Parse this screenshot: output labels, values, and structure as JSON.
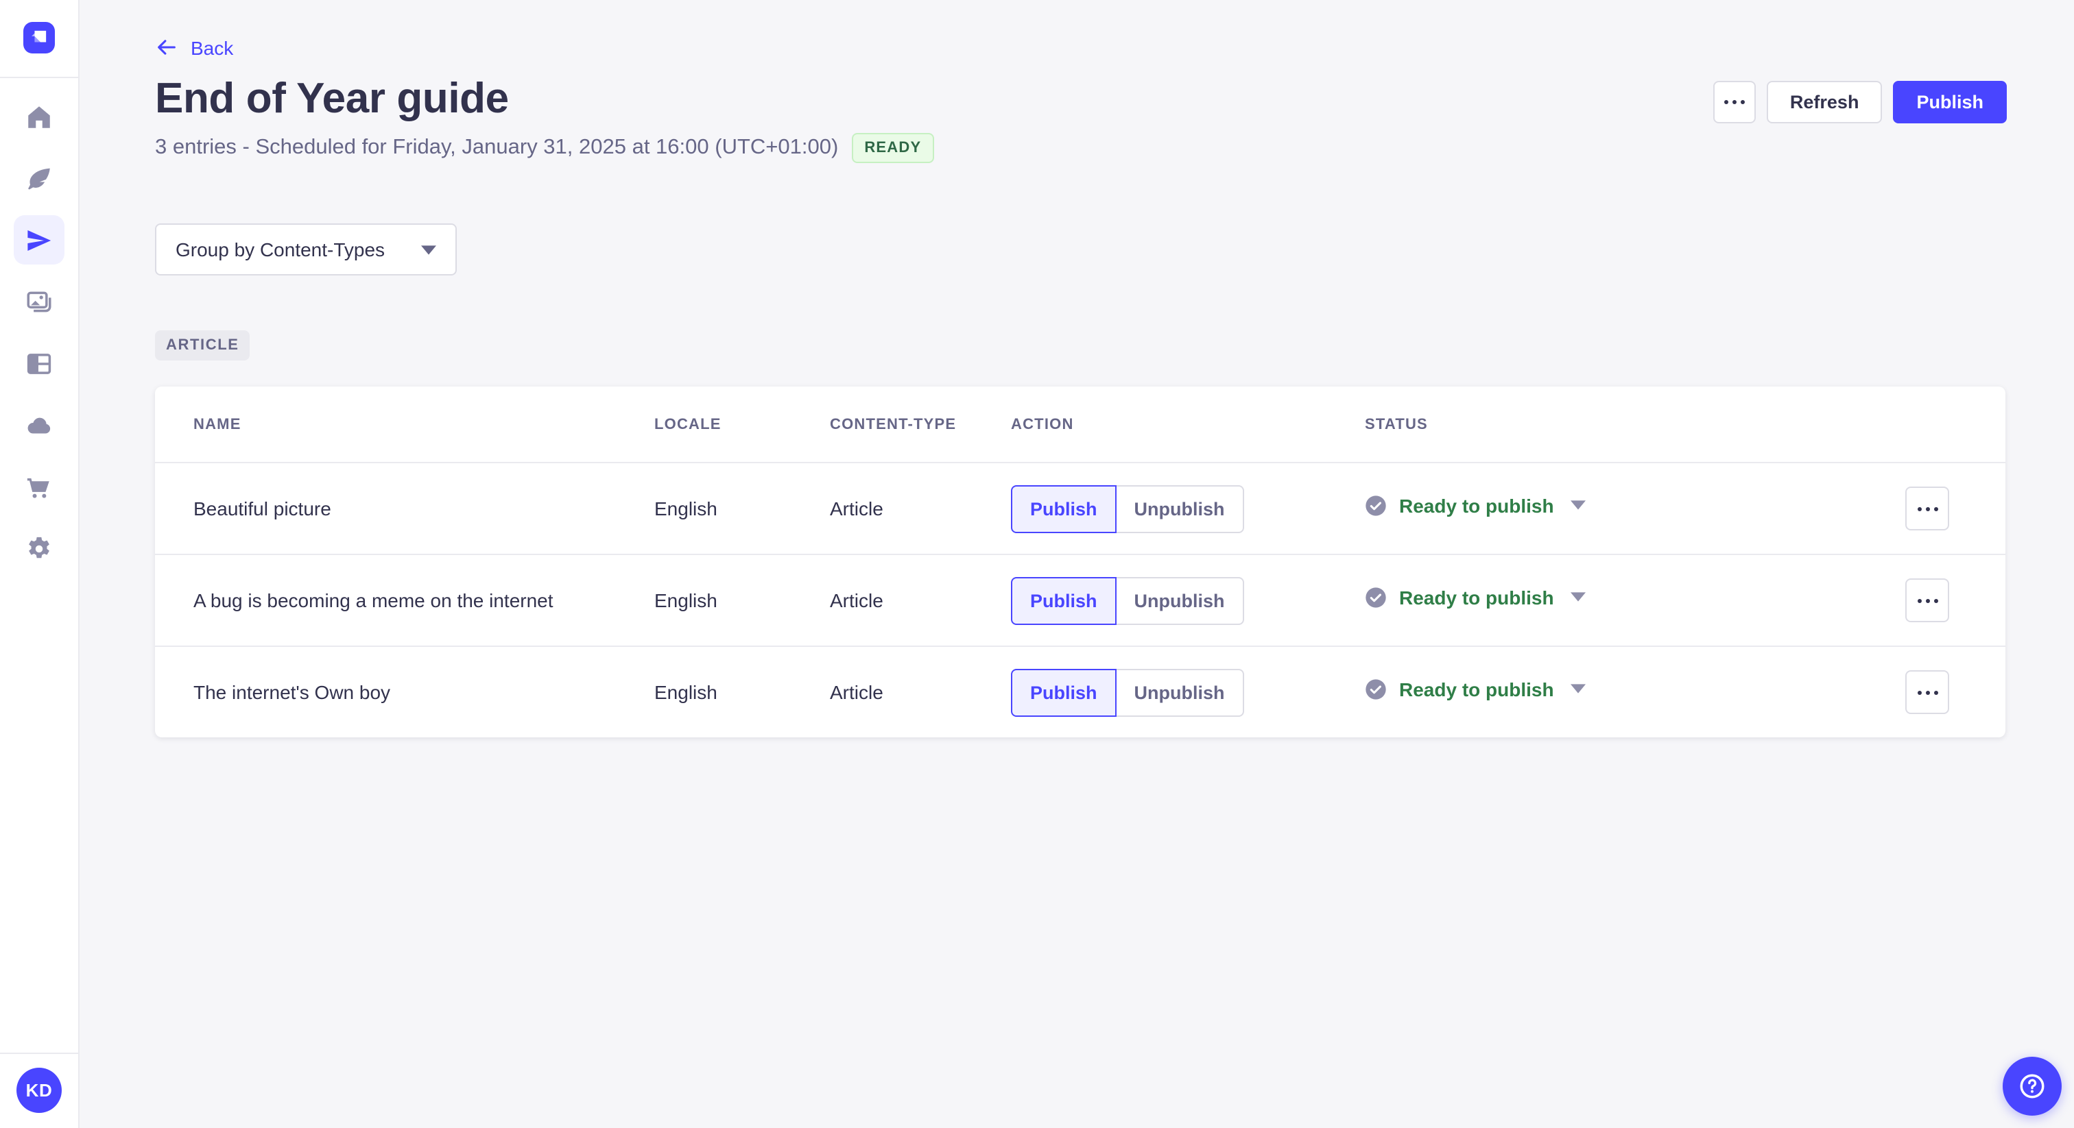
{
  "colors": {
    "accent": "#4945ff",
    "accent_light_bg": "#f0f0ff",
    "success_text": "#2f7e47",
    "success_badge_bg": "#eafbe7",
    "success_badge_border": "#c6f0c2",
    "neutral_text": "#32324d",
    "muted_text": "#666687",
    "border": "#dcdce4",
    "divider": "#eaeaef",
    "page_bg": "#f6f6f9"
  },
  "sidebar": {
    "logo_icon": "strapi-logo",
    "items": [
      {
        "icon": "home-icon",
        "active": false
      },
      {
        "icon": "feather-icon",
        "active": false
      },
      {
        "icon": "paper-plane-icon",
        "active": true
      },
      {
        "icon": "images-icon",
        "active": false
      },
      {
        "icon": "layout-icon",
        "active": false
      },
      {
        "icon": "cloud-icon",
        "active": false
      },
      {
        "icon": "cart-icon",
        "active": false
      },
      {
        "icon": "gear-icon",
        "active": false
      }
    ],
    "avatar_initials": "KD"
  },
  "header": {
    "back_label": "Back",
    "title": "End of Year guide",
    "subtitle": "3 entries - Scheduled for Friday, January 31, 2025 at 16:00 (UTC+01:00)",
    "status_badge": "READY",
    "refresh_label": "Refresh",
    "publish_label": "Publish",
    "more_icon": "ellipsis-icon"
  },
  "toolbar": {
    "group_by_label": "Group by Content-Types",
    "caret_icon": "chevron-down-icon"
  },
  "group": {
    "badge": "ARTICLE"
  },
  "table": {
    "columns": [
      "NAME",
      "LOCALE",
      "CONTENT-TYPE",
      "ACTION",
      "STATUS"
    ],
    "publish_label": "Publish",
    "unpublish_label": "Unpublish",
    "status_icon": "check-circle-icon",
    "rows": [
      {
        "name": "Beautiful picture",
        "locale": "English",
        "content_type": "Article",
        "status": "Ready to publish"
      },
      {
        "name": "A bug is becoming a meme on the internet",
        "locale": "English",
        "content_type": "Article",
        "status": "Ready to publish"
      },
      {
        "name": "The internet's Own boy",
        "locale": "English",
        "content_type": "Article",
        "status": "Ready to publish"
      }
    ]
  },
  "help": {
    "icon": "question-circle-icon"
  }
}
